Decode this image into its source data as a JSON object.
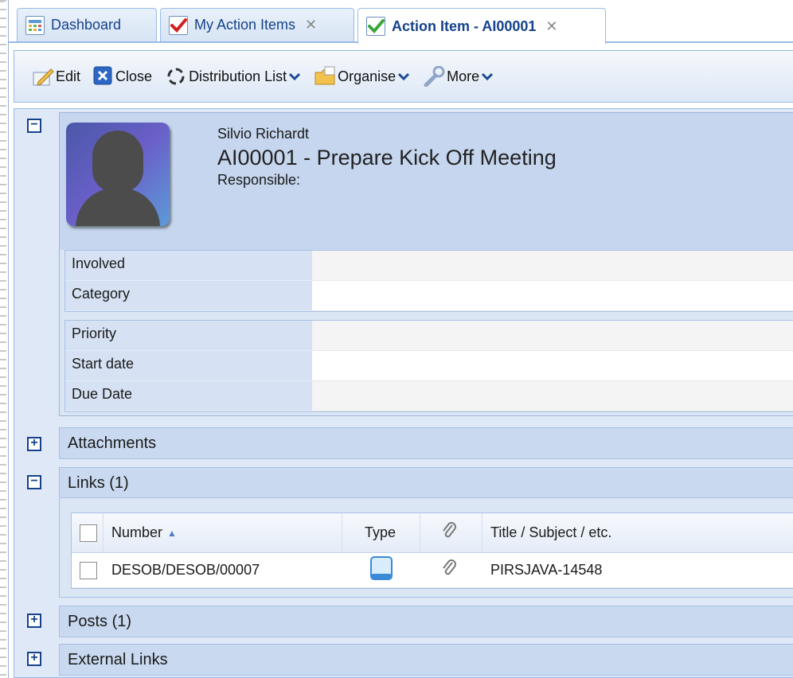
{
  "tabs": [
    {
      "label": "Dashboard",
      "closable": false,
      "icon": "dashboard-icon"
    },
    {
      "label": "My Action Items",
      "closable": true,
      "icon": "checkmark-red-icon"
    },
    {
      "label": "Action Item - AI00001",
      "closable": true,
      "icon": "checkmark-green-icon",
      "active": true
    }
  ],
  "close_glyph": "✕",
  "toolbar": {
    "edit": "Edit",
    "close": "Close",
    "distribution": "Distribution List",
    "organise": "Organise",
    "more": "More"
  },
  "header": {
    "name": "Silvio Richardt",
    "title": "AI00001 - Prepare Kick Off Meeting",
    "responsible": "Responsible:"
  },
  "fields_a": [
    {
      "label": "Involved",
      "value": ""
    },
    {
      "label": "Category",
      "value": ""
    }
  ],
  "fields_b": [
    {
      "label": "Priority",
      "value": ""
    },
    {
      "label": "Start date",
      "value": ""
    },
    {
      "label": "Due Date",
      "value": ""
    }
  ],
  "sections": {
    "attachments": "Attachments",
    "links": "Links (1)",
    "posts": "Posts (1)",
    "external_links": "External Links"
  },
  "links_grid": {
    "columns": [
      "Number",
      "Type",
      "",
      "Title / Subject / etc."
    ],
    "rows": [
      {
        "number": "DESOB/DESOB/00007",
        "type_icon": "document-icon",
        "attach_icon": "paperclip-icon",
        "title": "PIRSJAVA-14548"
      }
    ]
  },
  "colors": {
    "accent": "#15428b",
    "panel": "#c5d6ee",
    "border": "#99bbe8"
  }
}
